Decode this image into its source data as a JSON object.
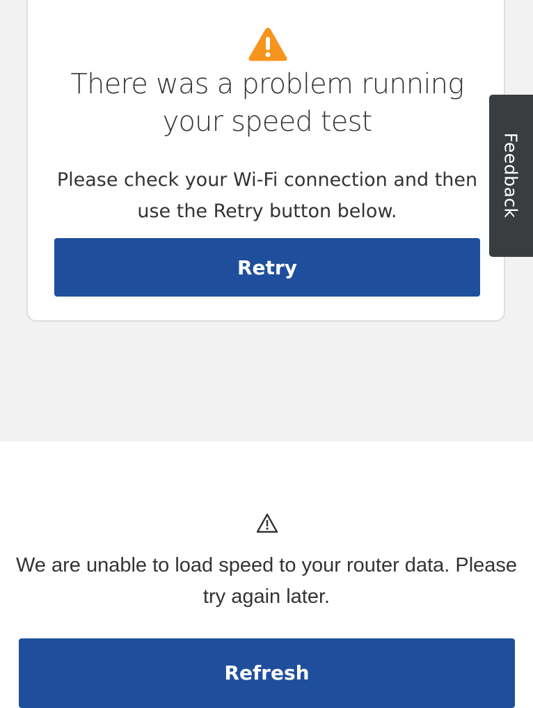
{
  "speed_test_error": {
    "title": "There was a problem running your speed test",
    "message": "Please check your Wi-Fi connection and then use the Retry button below.",
    "retry_label": "Retry",
    "icon": "warning-triangle-icon",
    "icon_color": "#f7941d"
  },
  "feedback_tab": {
    "label": "Feedback"
  },
  "router_data_error": {
    "icon": "warning-outline-icon",
    "message": "We are unable to load speed to your router data. Please try again later.",
    "refresh_label": "Refresh"
  },
  "colors": {
    "primary_button": "#1f4f9c",
    "feedback_tab": "#3a3d40",
    "page_background_top": "#f2f2f2"
  }
}
